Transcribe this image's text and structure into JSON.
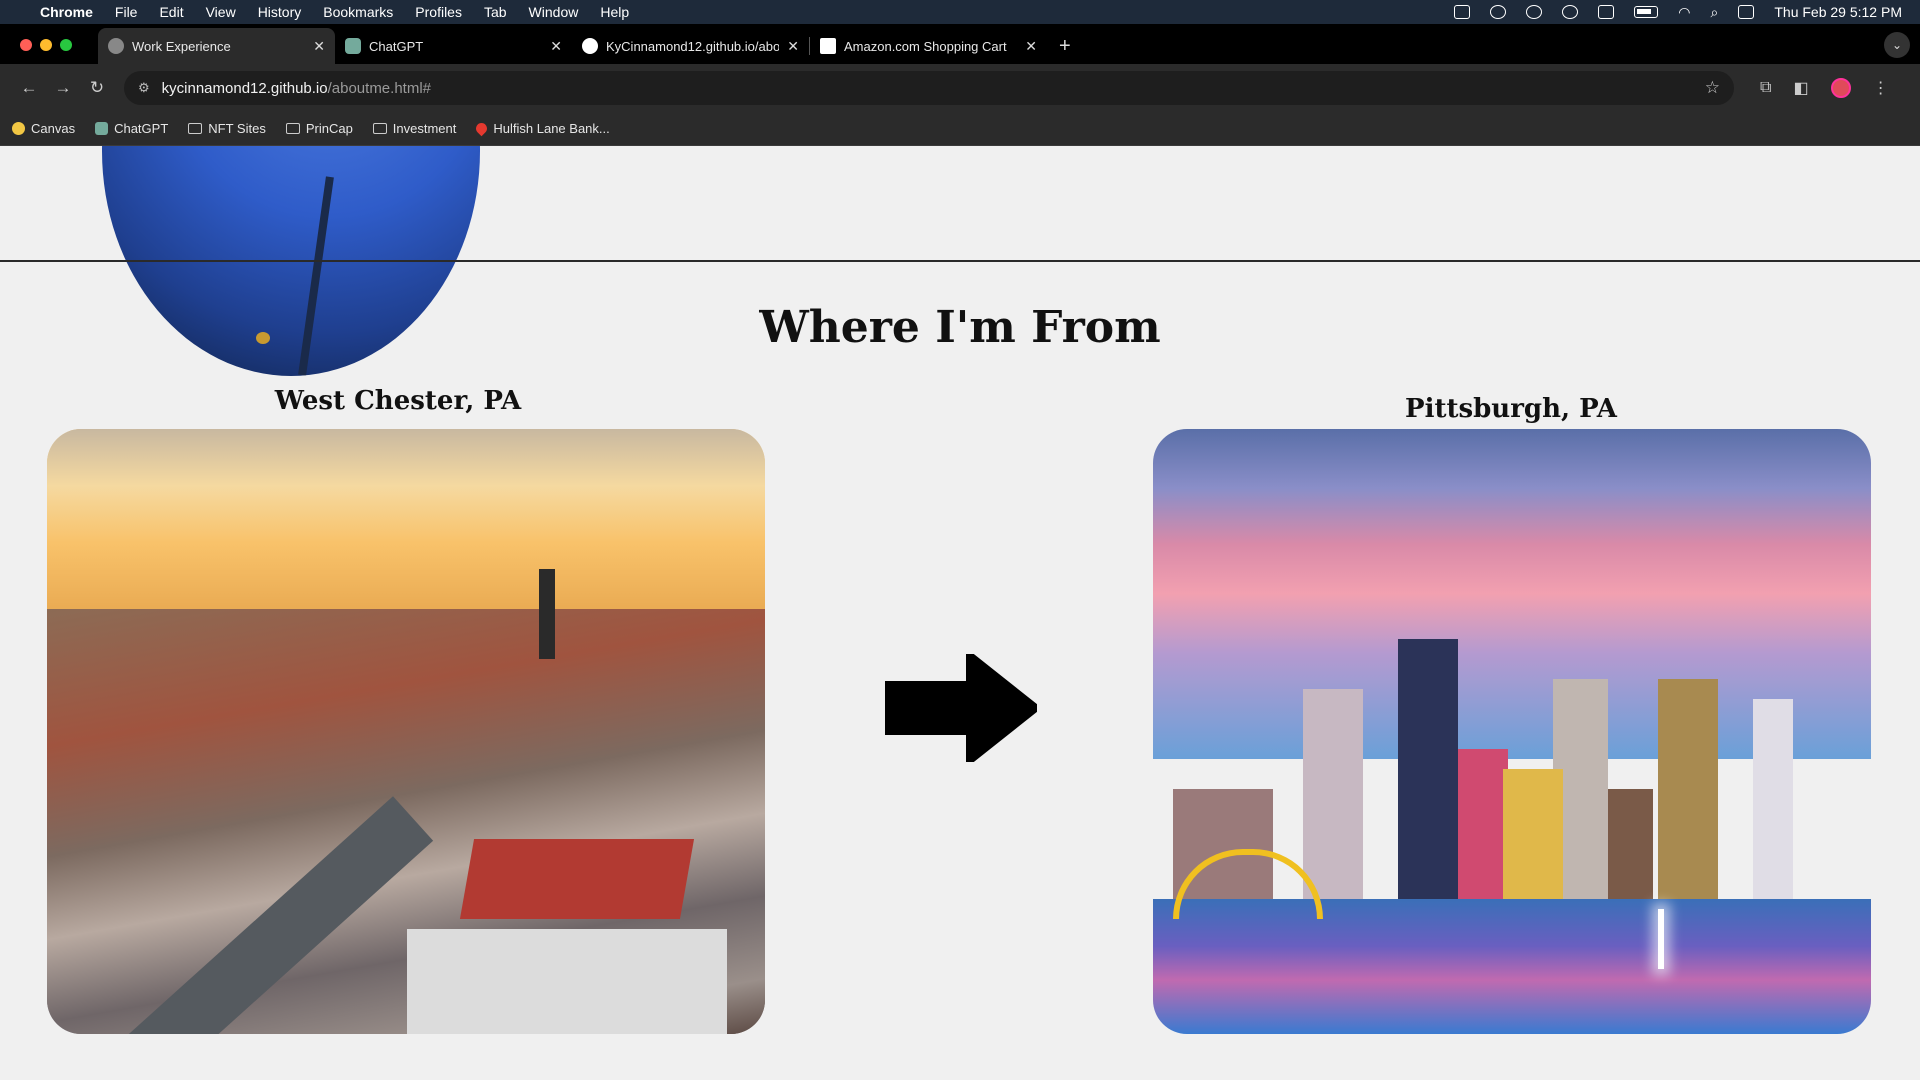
{
  "menubar": {
    "app": "Chrome",
    "items": [
      "File",
      "Edit",
      "View",
      "History",
      "Bookmarks",
      "Profiles",
      "Tab",
      "Window",
      "Help"
    ],
    "datetime": "Thu Feb 29  5:12 PM"
  },
  "tabs": [
    {
      "title": "Work Experience",
      "active": true
    },
    {
      "title": "ChatGPT",
      "active": false
    },
    {
      "title": "KyCinnamond12.github.io/abo",
      "active": false
    },
    {
      "title": "Amazon.com Shopping Cart",
      "active": false
    }
  ],
  "toolbar": {
    "url_host": "kycinnamond12.github.io",
    "url_path": "/aboutme.html#"
  },
  "bookmarks": [
    {
      "label": "Canvas",
      "icon": "canvas-icon"
    },
    {
      "label": "ChatGPT",
      "icon": "chatgpt-icon"
    },
    {
      "label": "NFT Sites",
      "icon": "folder-icon"
    },
    {
      "label": "PrinCap",
      "icon": "folder-icon"
    },
    {
      "label": "Investment",
      "icon": "folder-icon"
    },
    {
      "label": "Hulfish Lane Bank...",
      "icon": "map-pin-icon"
    }
  ],
  "page": {
    "section_title": "Where I'm From",
    "from_label": "West Chester, PA",
    "to_label": "Pittsburgh, PA"
  }
}
